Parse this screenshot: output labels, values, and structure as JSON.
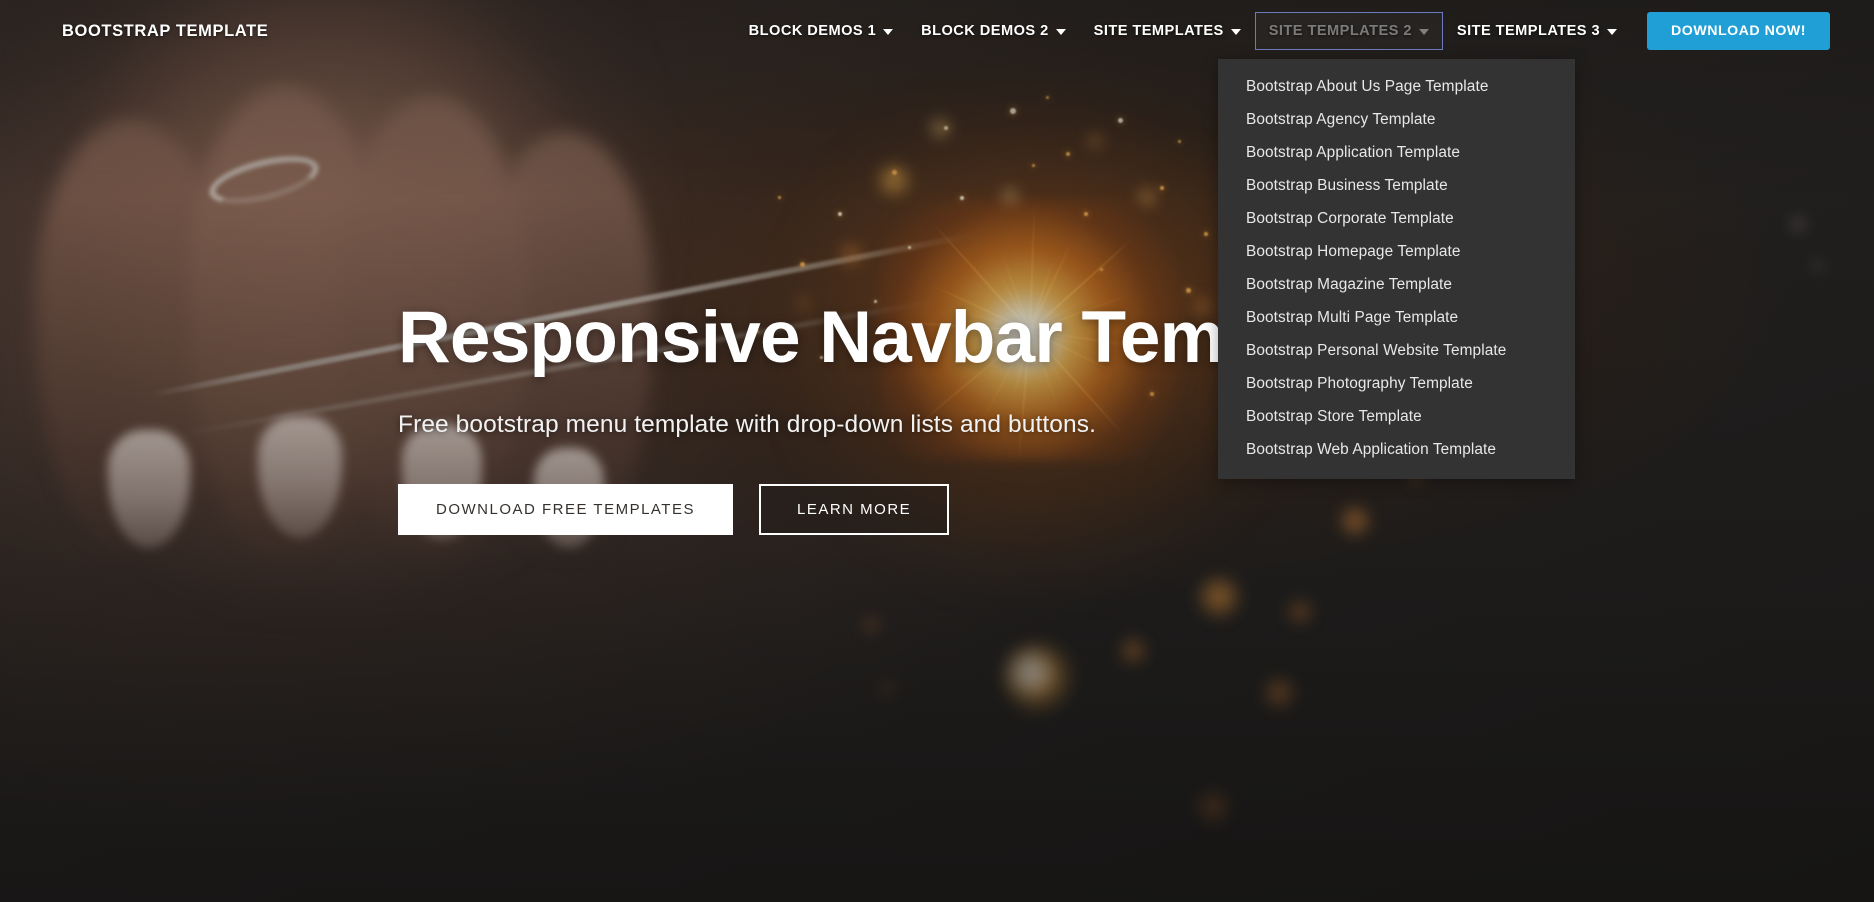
{
  "navbar": {
    "brand": "BOOTSTRAP TEMPLATE",
    "accent_color": "#1f9fd6",
    "focus_outline_color": "#6b7bbd",
    "items": [
      {
        "label": "BLOCK DEMOS 1",
        "has_caret": true,
        "focused": false
      },
      {
        "label": "BLOCK DEMOS 2",
        "has_caret": true,
        "focused": false
      },
      {
        "label": "SITE TEMPLATES",
        "has_caret": true,
        "focused": false
      },
      {
        "label": "SITE TEMPLATES 2",
        "has_caret": true,
        "focused": true
      },
      {
        "label": "SITE TEMPLATES 3",
        "has_caret": true,
        "focused": false
      }
    ],
    "download_button": "DOWNLOAD NOW!"
  },
  "dropdown": {
    "open_for": "SITE TEMPLATES 2",
    "background_color": "#333333",
    "items": [
      {
        "label": "Bootstrap About Us Page Template"
      },
      {
        "label": "Bootstrap Agency Template"
      },
      {
        "label": "Bootstrap Application Template"
      },
      {
        "label": "Bootstrap Business Template"
      },
      {
        "label": "Bootstrap Corporate Template"
      },
      {
        "label": "Bootstrap Homepage Template"
      },
      {
        "label": "Bootstrap Magazine Template"
      },
      {
        "label": "Bootstrap Multi Page Template"
      },
      {
        "label": "Bootstrap Personal Website Template"
      },
      {
        "label": "Bootstrap Photography Template"
      },
      {
        "label": "Bootstrap Store Template"
      },
      {
        "label": "Bootstrap Web Application Template"
      }
    ]
  },
  "hero": {
    "title": "Responsive Navbar Template",
    "subtitle": "Free bootstrap menu template with drop-down lists and buttons.",
    "primary_button": "DOWNLOAD FREE TEMPLATES",
    "secondary_button": "LEARN MORE"
  }
}
